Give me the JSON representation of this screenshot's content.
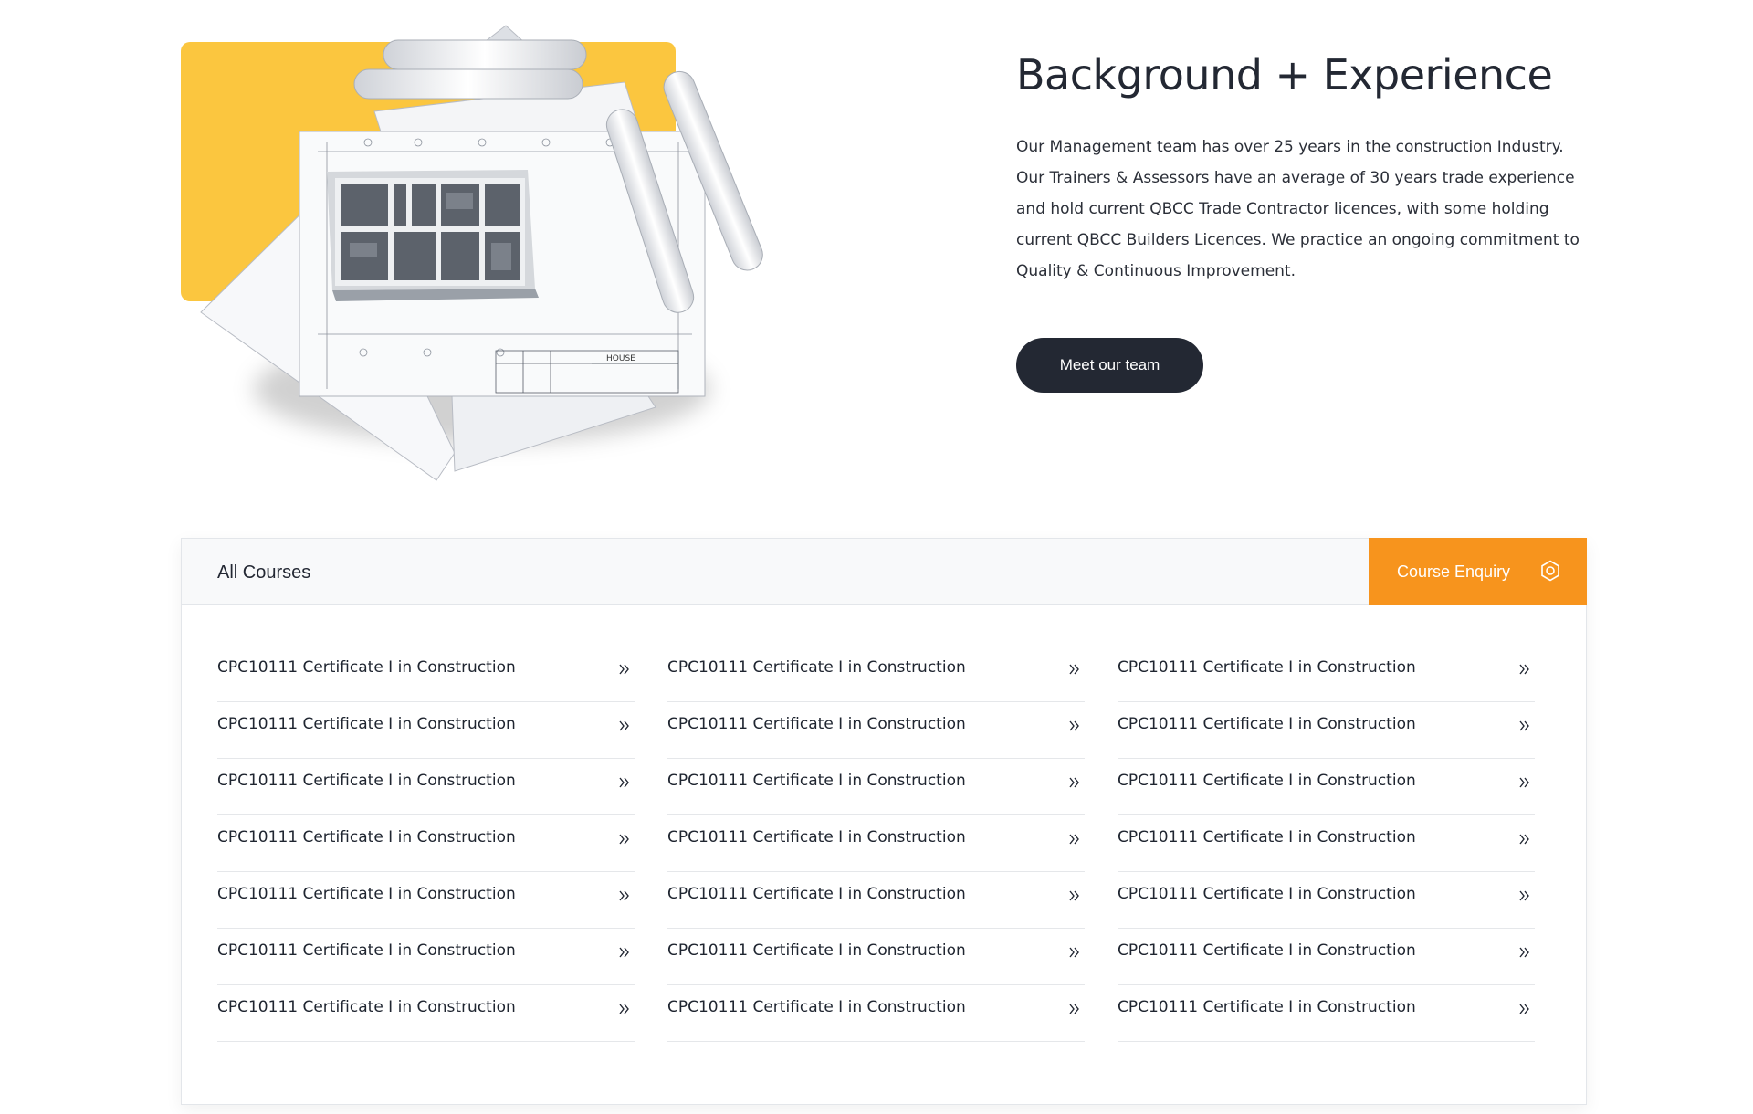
{
  "hero": {
    "title": "Background + Experience",
    "body": "Our Management team has over 25 years in the construction Industry. Our Trainers & Assessors have an average of 30 years trade experience and hold current QBCC Trade Contractor licences, with some holding current QBCC Builders Licences. We practice an ongoing commitment to Quality & Continuous Improvement.",
    "button_label": "Meet our team",
    "image_label": "HOUSE"
  },
  "courses": {
    "title": "All Courses",
    "enquiry_label": "Course Enquiry",
    "columns": [
      [
        "CPC10111 Certificate I in Construction",
        "CPC10111 Certificate I in Construction",
        "CPC10111 Certificate I in Construction",
        "CPC10111 Certificate I in Construction",
        "CPC10111 Certificate I in Construction",
        "CPC10111 Certificate I in Construction",
        "CPC10111 Certificate I in Construction"
      ],
      [
        "CPC10111 Certificate I in Construction",
        "CPC10111 Certificate I in Construction",
        "CPC10111 Certificate I in Construction",
        "CPC10111 Certificate I in Construction",
        "CPC10111 Certificate I in Construction",
        "CPC10111 Certificate I in Construction",
        "CPC10111 Certificate I in Construction"
      ],
      [
        "CPC10111 Certificate I in Construction",
        "CPC10111 Certificate I in Construction",
        "CPC10111 Certificate I in Construction",
        "CPC10111 Certificate I in Construction",
        "CPC10111 Certificate I in Construction",
        "CPC10111 Certificate I in Construction",
        "CPC10111 Certificate I in Construction"
      ]
    ]
  },
  "icons": {
    "enquiry": "gear-icon",
    "course_item": "double-chevron-right-icon"
  },
  "colors": {
    "accent_yellow": "#fbc63f",
    "accent_orange": "#f7941d",
    "dark": "#232833"
  }
}
